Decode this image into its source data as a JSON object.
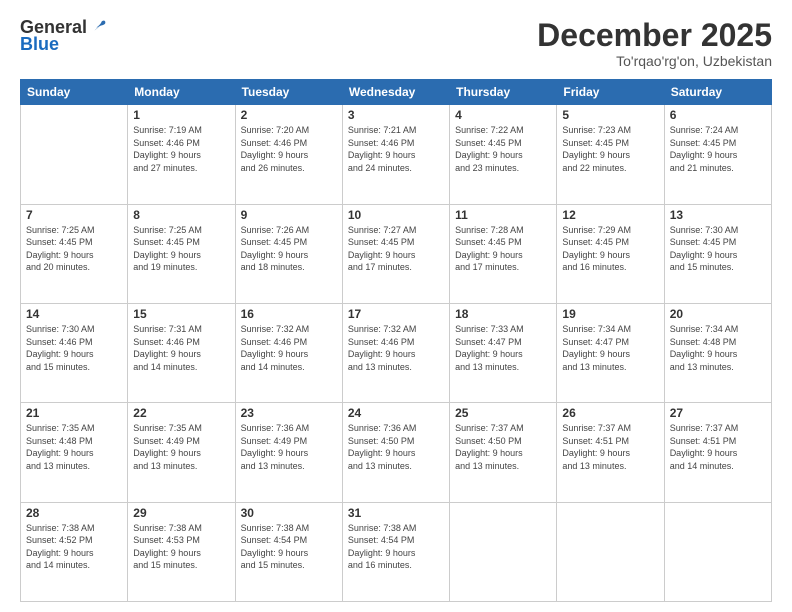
{
  "logo": {
    "general": "General",
    "blue": "Blue"
  },
  "header": {
    "month": "December 2025",
    "location": "To'rqao'rg'on, Uzbekistan"
  },
  "weekdays": [
    "Sunday",
    "Monday",
    "Tuesday",
    "Wednesday",
    "Thursday",
    "Friday",
    "Saturday"
  ],
  "weeks": [
    [
      {
        "day": "",
        "info": ""
      },
      {
        "day": "1",
        "info": "Sunrise: 7:19 AM\nSunset: 4:46 PM\nDaylight: 9 hours\nand 27 minutes."
      },
      {
        "day": "2",
        "info": "Sunrise: 7:20 AM\nSunset: 4:46 PM\nDaylight: 9 hours\nand 26 minutes."
      },
      {
        "day": "3",
        "info": "Sunrise: 7:21 AM\nSunset: 4:46 PM\nDaylight: 9 hours\nand 24 minutes."
      },
      {
        "day": "4",
        "info": "Sunrise: 7:22 AM\nSunset: 4:45 PM\nDaylight: 9 hours\nand 23 minutes."
      },
      {
        "day": "5",
        "info": "Sunrise: 7:23 AM\nSunset: 4:45 PM\nDaylight: 9 hours\nand 22 minutes."
      },
      {
        "day": "6",
        "info": "Sunrise: 7:24 AM\nSunset: 4:45 PM\nDaylight: 9 hours\nand 21 minutes."
      }
    ],
    [
      {
        "day": "7",
        "info": "Sunrise: 7:25 AM\nSunset: 4:45 PM\nDaylight: 9 hours\nand 20 minutes."
      },
      {
        "day": "8",
        "info": "Sunrise: 7:25 AM\nSunset: 4:45 PM\nDaylight: 9 hours\nand 19 minutes."
      },
      {
        "day": "9",
        "info": "Sunrise: 7:26 AM\nSunset: 4:45 PM\nDaylight: 9 hours\nand 18 minutes."
      },
      {
        "day": "10",
        "info": "Sunrise: 7:27 AM\nSunset: 4:45 PM\nDaylight: 9 hours\nand 17 minutes."
      },
      {
        "day": "11",
        "info": "Sunrise: 7:28 AM\nSunset: 4:45 PM\nDaylight: 9 hours\nand 17 minutes."
      },
      {
        "day": "12",
        "info": "Sunrise: 7:29 AM\nSunset: 4:45 PM\nDaylight: 9 hours\nand 16 minutes."
      },
      {
        "day": "13",
        "info": "Sunrise: 7:30 AM\nSunset: 4:45 PM\nDaylight: 9 hours\nand 15 minutes."
      }
    ],
    [
      {
        "day": "14",
        "info": "Sunrise: 7:30 AM\nSunset: 4:46 PM\nDaylight: 9 hours\nand 15 minutes."
      },
      {
        "day": "15",
        "info": "Sunrise: 7:31 AM\nSunset: 4:46 PM\nDaylight: 9 hours\nand 14 minutes."
      },
      {
        "day": "16",
        "info": "Sunrise: 7:32 AM\nSunset: 4:46 PM\nDaylight: 9 hours\nand 14 minutes."
      },
      {
        "day": "17",
        "info": "Sunrise: 7:32 AM\nSunset: 4:46 PM\nDaylight: 9 hours\nand 13 minutes."
      },
      {
        "day": "18",
        "info": "Sunrise: 7:33 AM\nSunset: 4:47 PM\nDaylight: 9 hours\nand 13 minutes."
      },
      {
        "day": "19",
        "info": "Sunrise: 7:34 AM\nSunset: 4:47 PM\nDaylight: 9 hours\nand 13 minutes."
      },
      {
        "day": "20",
        "info": "Sunrise: 7:34 AM\nSunset: 4:48 PM\nDaylight: 9 hours\nand 13 minutes."
      }
    ],
    [
      {
        "day": "21",
        "info": "Sunrise: 7:35 AM\nSunset: 4:48 PM\nDaylight: 9 hours\nand 13 minutes."
      },
      {
        "day": "22",
        "info": "Sunrise: 7:35 AM\nSunset: 4:49 PM\nDaylight: 9 hours\nand 13 minutes."
      },
      {
        "day": "23",
        "info": "Sunrise: 7:36 AM\nSunset: 4:49 PM\nDaylight: 9 hours\nand 13 minutes."
      },
      {
        "day": "24",
        "info": "Sunrise: 7:36 AM\nSunset: 4:50 PM\nDaylight: 9 hours\nand 13 minutes."
      },
      {
        "day": "25",
        "info": "Sunrise: 7:37 AM\nSunset: 4:50 PM\nDaylight: 9 hours\nand 13 minutes."
      },
      {
        "day": "26",
        "info": "Sunrise: 7:37 AM\nSunset: 4:51 PM\nDaylight: 9 hours\nand 13 minutes."
      },
      {
        "day": "27",
        "info": "Sunrise: 7:37 AM\nSunset: 4:51 PM\nDaylight: 9 hours\nand 14 minutes."
      }
    ],
    [
      {
        "day": "28",
        "info": "Sunrise: 7:38 AM\nSunset: 4:52 PM\nDaylight: 9 hours\nand 14 minutes."
      },
      {
        "day": "29",
        "info": "Sunrise: 7:38 AM\nSunset: 4:53 PM\nDaylight: 9 hours\nand 15 minutes."
      },
      {
        "day": "30",
        "info": "Sunrise: 7:38 AM\nSunset: 4:54 PM\nDaylight: 9 hours\nand 15 minutes."
      },
      {
        "day": "31",
        "info": "Sunrise: 7:38 AM\nSunset: 4:54 PM\nDaylight: 9 hours\nand 16 minutes."
      },
      {
        "day": "",
        "info": ""
      },
      {
        "day": "",
        "info": ""
      },
      {
        "day": "",
        "info": ""
      }
    ]
  ]
}
